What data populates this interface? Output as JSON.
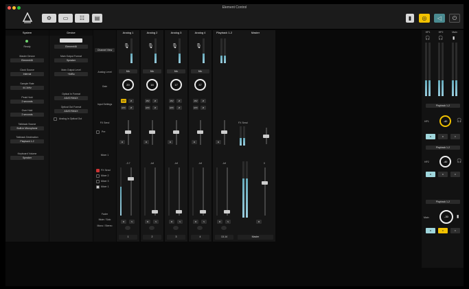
{
  "window": {
    "title": "Element Control"
  },
  "colors": {
    "accent": "#f2c200",
    "teal": "#6fc3cc",
    "mute": "#9fd6dc"
  },
  "system": {
    "header": "System",
    "status_value": "Ready",
    "items": [
      {
        "label": "Master Device",
        "value": "Element46"
      },
      {
        "label": "Clock Source",
        "value": "Internal"
      },
      {
        "label": "Sample Rate",
        "value": "44.1kHz"
      },
      {
        "label": "Peak Hold",
        "value": "2 seconds"
      },
      {
        "label": "Over Hold",
        "value": "2 seconds"
      },
      {
        "label": "Talkback Source",
        "value": "Built-in Microphone"
      },
      {
        "label": "Talkback Destination",
        "value": "Playback 1-2"
      },
      {
        "label": "Keyboard Volume",
        "value": "Speaker"
      }
    ]
  },
  "device": {
    "header": "Device",
    "name": "Element46",
    "items": [
      {
        "label": "Main Output Format",
        "value": "Speaker"
      },
      {
        "label": "Main Output Level",
        "value": "+4dBu"
      },
      {
        "label": "Optical In Format",
        "value": "ADAT/SMUX"
      },
      {
        "label": "Optical Out Format",
        "value": "ADAT/SMUX"
      }
    ],
    "checkbox_label": "Analog In Optical Out"
  },
  "row_labels": {
    "channel_view": "Channel View",
    "analog_level": "Analog Level",
    "gain": "Gain",
    "input_settings": "Input Settings",
    "fx_send": "FX Send",
    "pre": "Pre",
    "mixer1": "Mixer 1",
    "fader": "Fader",
    "mute_solo": "Mute / Solo",
    "mono_stereo": "Mono / Stereo"
  },
  "mixers": {
    "fx_send": "FX Send",
    "mixer2": "Mixer 2",
    "mixer3": "Mixer 3",
    "mixer1": "Mixer 1"
  },
  "channels": [
    {
      "name": "Analog 1",
      "level": "Mic",
      "gain": "20",
      "fader": "-3.7",
      "number": "1",
      "on48": true
    },
    {
      "name": "Analog 2",
      "level": "Mic",
      "gain": "16",
      "fader": "-Inf",
      "number": "2",
      "on48": false
    },
    {
      "name": "Analog 3",
      "level": "Mic",
      "gain": "17",
      "fader": "-Inf",
      "number": "3",
      "on48": false
    },
    {
      "name": "Analog 4",
      "level": "Mic",
      "gain": "37",
      "fader": "-Inf",
      "number": "4",
      "on48": false
    },
    {
      "name": "Playback 1-2",
      "fader": "-Inf",
      "number": "13-14"
    }
  ],
  "master": {
    "name": "Master",
    "fx_send": "FX Send",
    "fader": "0",
    "number": "Master"
  },
  "button_labels": {
    "p48": "48V",
    "phase": "Ø",
    "hpf": "HPF",
    "pad": "Ø",
    "m": "M",
    "s": "S"
  },
  "outputs": {
    "headers": [
      "HP1",
      "HP2",
      "Main"
    ],
    "hp1": {
      "source": "Playback 1-2",
      "label": "HP1",
      "value": "-40"
    },
    "hp2": {
      "source": "Playback 1-2",
      "label": "HP2",
      "value": "-40"
    },
    "main": {
      "source": "Playback 1-2",
      "label": "Main",
      "value": "-30"
    },
    "btns": [
      "M",
      "D",
      "Σ"
    ]
  }
}
